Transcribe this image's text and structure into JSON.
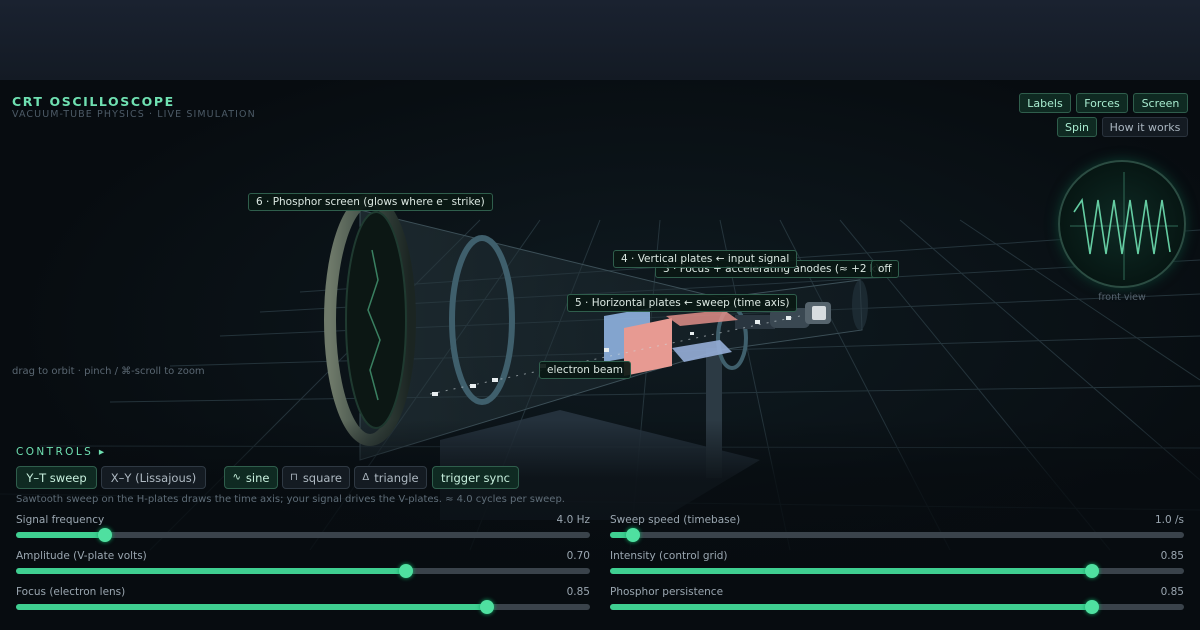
{
  "header": {
    "title": "CRT OSCILLOSCOPE",
    "subtitle": "VACUUM-TUBE PHYSICS · LIVE SIMULATION"
  },
  "toolbar": {
    "labels": "Labels",
    "forces": "Forces",
    "screen": "Screen",
    "spin": "Spin",
    "how_it_works": "How it works"
  },
  "front_view": {
    "label": "front view"
  },
  "scene_labels": {
    "phosphor": "6 · Phosphor screen (glows where e⁻ strike)",
    "vertical_plates": "4 · Vertical plates ← input signal",
    "anodes": "3 · Focus + accelerating anodes (≈ +2 kV)",
    "anodes_suffix": "off",
    "horizontal_plates": "5 · Horizontal plates ← sweep (time axis)",
    "electron_beam": "electron beam"
  },
  "hint": "drag to orbit · pinch / ⌘-scroll to zoom",
  "controls": {
    "heading": "CONTROLS ▸",
    "modes": [
      "Y–T sweep",
      "X–Y (Lissajous)"
    ],
    "active_mode": "Y–T sweep",
    "waves": [
      {
        "icon": "∿",
        "label": "sine"
      },
      {
        "icon": "⊓",
        "label": "square"
      },
      {
        "icon": "Δ",
        "label": "triangle"
      }
    ],
    "active_wave": "sine",
    "trigger": "trigger sync",
    "trigger_on": true,
    "description": "Sawtooth sweep on the H-plates draws the time axis; your signal drives the V-plates. ≈ 4.0 cycles per sweep."
  },
  "sliders": [
    {
      "label": "Signal frequency",
      "value": "4.0 Hz",
      "fraction": 0.155
    },
    {
      "label": "Sweep speed (timebase)",
      "value": "1.0 /s",
      "fraction": 0.04
    },
    {
      "label": "Amplitude (V-plate volts)",
      "value": "0.70",
      "fraction": 0.68
    },
    {
      "label": "Intensity (control grid)",
      "value": "0.85",
      "fraction": 0.84
    },
    {
      "label": "Focus (electron lens)",
      "value": "0.85",
      "fraction": 0.82
    },
    {
      "label": "Phosphor persistence",
      "value": "0.85",
      "fraction": 0.84
    }
  ],
  "colors": {
    "accent": "#6fe0b1",
    "slider_fill": "#3fcf91",
    "plate_vertical_a": "#8fb3e0",
    "plate_vertical_b": "#e79a92",
    "plate_horizontal_a": "#e08e88",
    "plate_horizontal_b": "#96aed8"
  }
}
